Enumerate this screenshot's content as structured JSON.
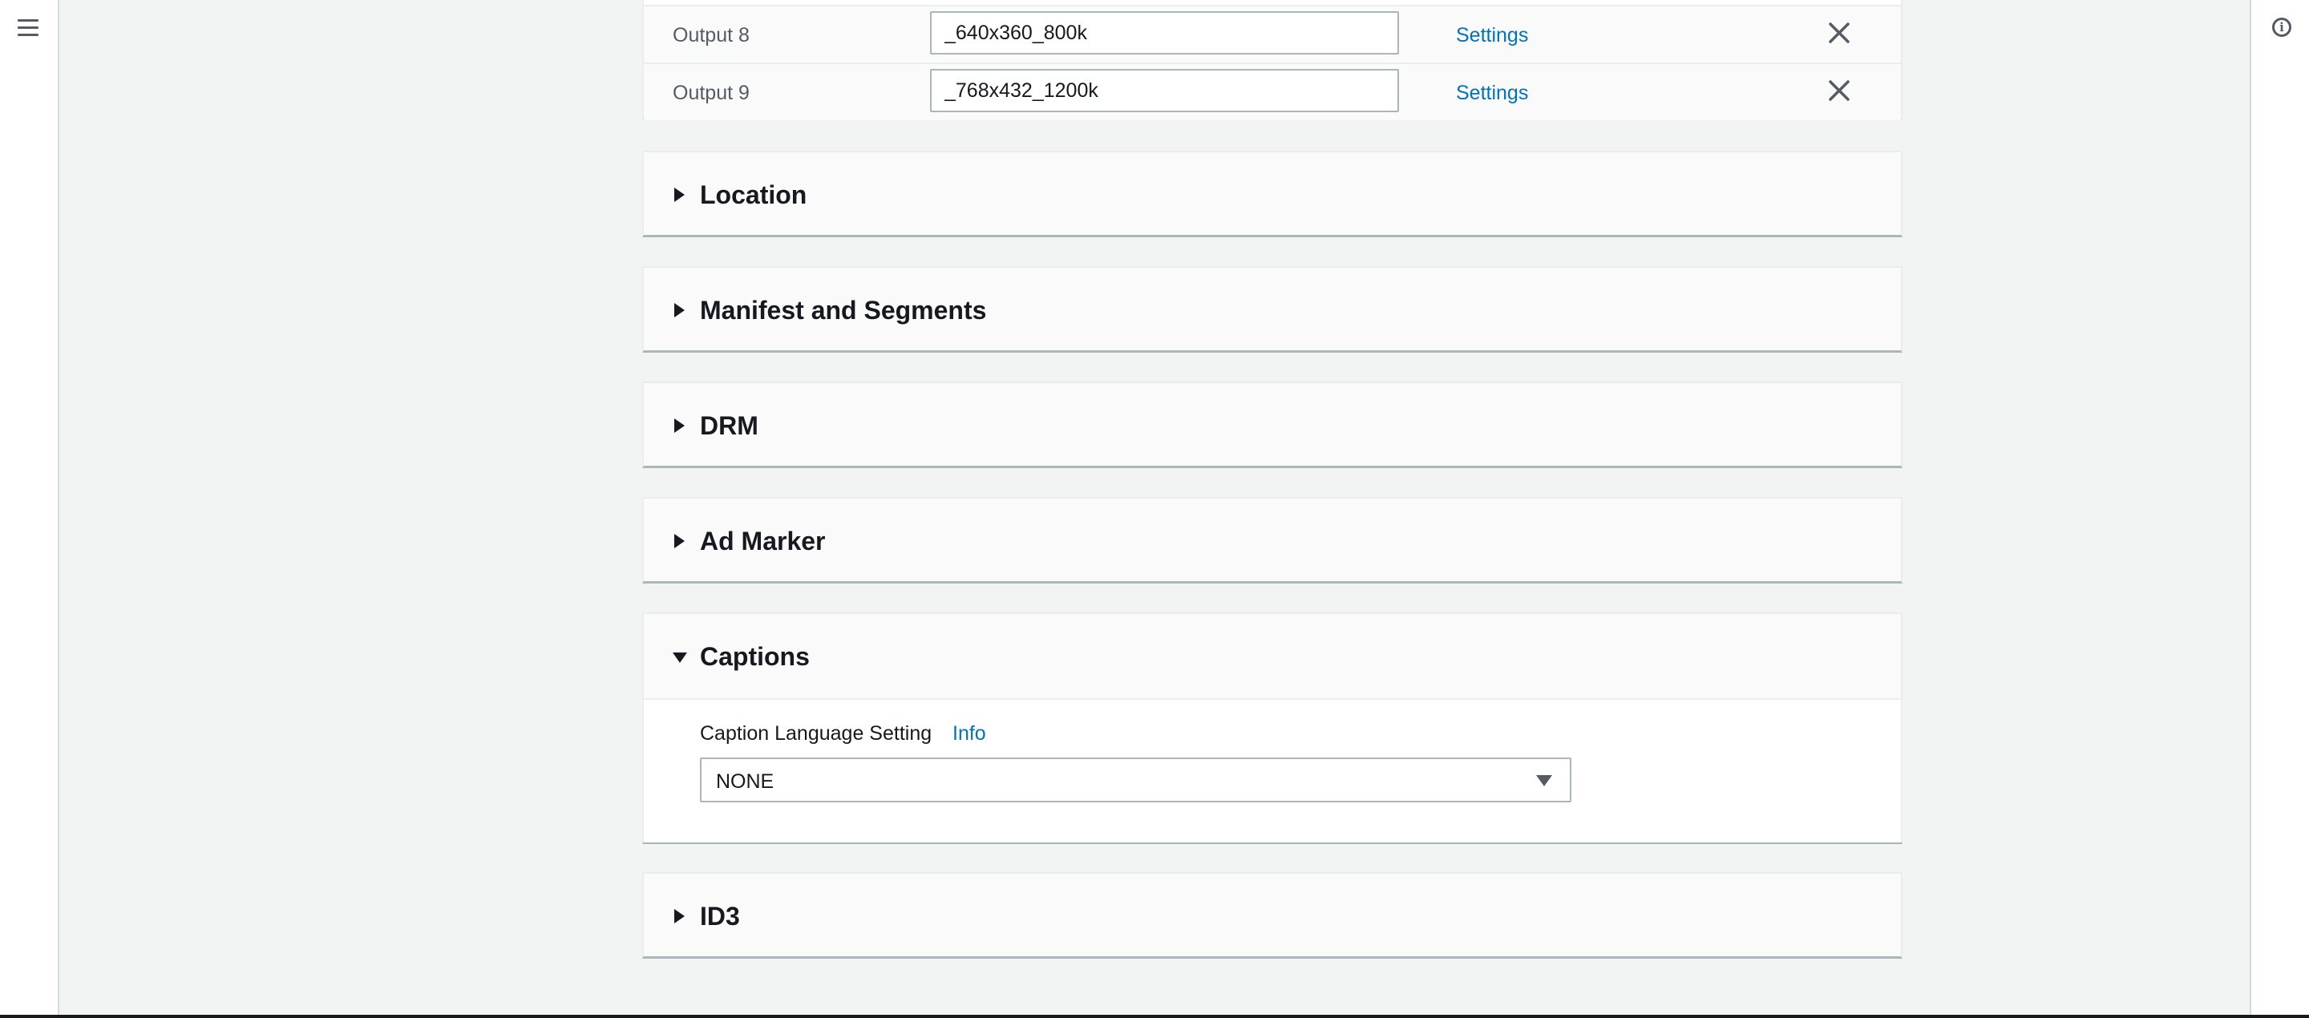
{
  "outputs": [
    {
      "label": "Output 8",
      "name_modifier": "_640x360_800k",
      "settings_label": "Settings"
    },
    {
      "label": "Output 9",
      "name_modifier": "_768x432_1200k",
      "settings_label": "Settings"
    }
  ],
  "sections": {
    "location": "Location",
    "manifest": "Manifest and Segments",
    "drm": "DRM",
    "ad_marker": "Ad Marker",
    "captions": "Captions",
    "id3": "ID3"
  },
  "captions": {
    "field_label": "Caption Language Setting",
    "info_label": "Info",
    "selected_value": "NONE"
  },
  "icons": {
    "menu": "hamburger-menu-icon",
    "info": "info-circle-icon",
    "remove": "close-icon",
    "collapsed": "caret-right-icon",
    "expanded": "caret-down-icon",
    "dropdown": "caret-down-icon"
  },
  "colors": {
    "link": "#0073bb",
    "background": "#f2f3f3",
    "text": "#16191f"
  }
}
